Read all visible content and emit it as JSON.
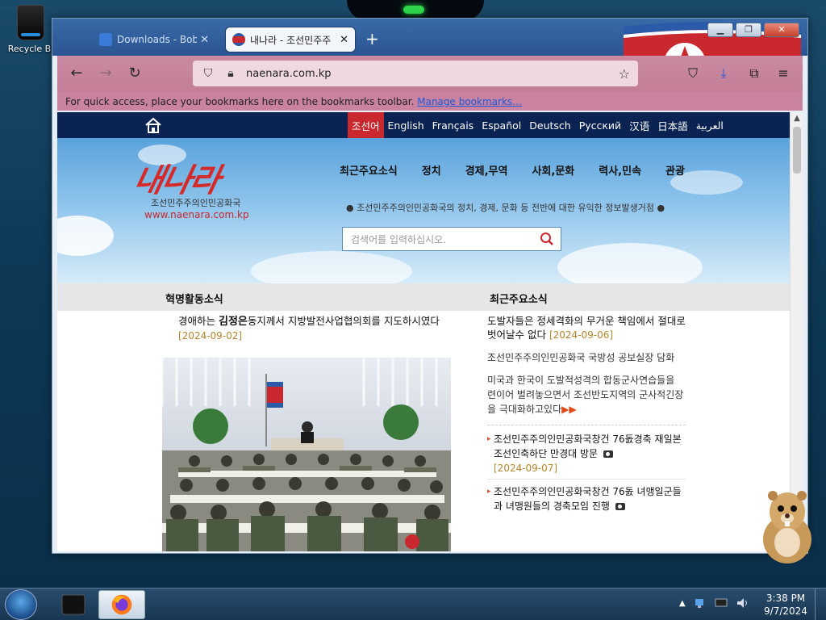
{
  "desktop": {
    "recycle_bin_label": "Recycle Bi"
  },
  "browser": {
    "tabs": [
      {
        "label": "Downloads - Bob P",
        "active": false
      },
      {
        "label": "내나라 - 조선민주주",
        "active": true
      }
    ],
    "url": "naenara.com.kp",
    "bookmarks_bar": {
      "text": "For quick access, place your bookmarks here on the bookmarks toolbar.",
      "link": "Manage bookmarks…"
    }
  },
  "site": {
    "languages": [
      "조선어",
      "English",
      "Français",
      "Español",
      "Deutsch",
      "Русский",
      "汉语",
      "日本語",
      "العربية"
    ],
    "active_language": "조선어",
    "logo": "내나라",
    "logo_subtitle": "조선민주주의인민공화국",
    "logo_url": "www.naenara.com.kp",
    "nav": [
      "최근주요소식",
      "정치",
      "경제,무역",
      "사회,문화",
      "력사,민속",
      "관광"
    ],
    "tagline": "● 조선민주주의인민공화국의 정치, 경제, 문화 등 전반에 대한 유익한 정보발생거점 ●",
    "search_placeholder": "검색어를 입력하십시오.",
    "left_section_title": "혁명활동소식",
    "right_section_title": "최근주요소식",
    "left_headline_pre": "경애하는 ",
    "left_headline_name": "김정은",
    "left_headline_post": "동지께서 지방발전사업협의회를 지도하시였다",
    "left_headline_date": "[2024-09-02]",
    "right_headline": "도발자들은 정세격화의 무거운 책임에서 절대로 벗어날수 없다",
    "right_headline_date": "[2024-09-06]",
    "right_para1": "조선민주주의인민공화국 국방성 공보실장 담화",
    "right_para2": "미국과 한국이 도발적성격의 합동군사연습들을 련이어 벌려놓으면서 조선반도지역의 군사적긴장을 극대화하고있다",
    "more_marker": "▶▶",
    "news_items": [
      {
        "text": "조선민주주의인민공화국창건 76돐경축 재일본조선인축하단 만경대 방문",
        "date": "[2024-09-07]"
      },
      {
        "text": "조선민주주의인민공화국창건 76돐 녀맹일군들과 녀맹원들의 경축모임 진행",
        "date": ""
      }
    ]
  },
  "taskbar": {
    "time": "3:38 PM",
    "date": "9/7/2024"
  },
  "colors": {
    "lang_bar": "#0a2352",
    "lang_active": "#c8282e",
    "date": "#b3862e"
  }
}
